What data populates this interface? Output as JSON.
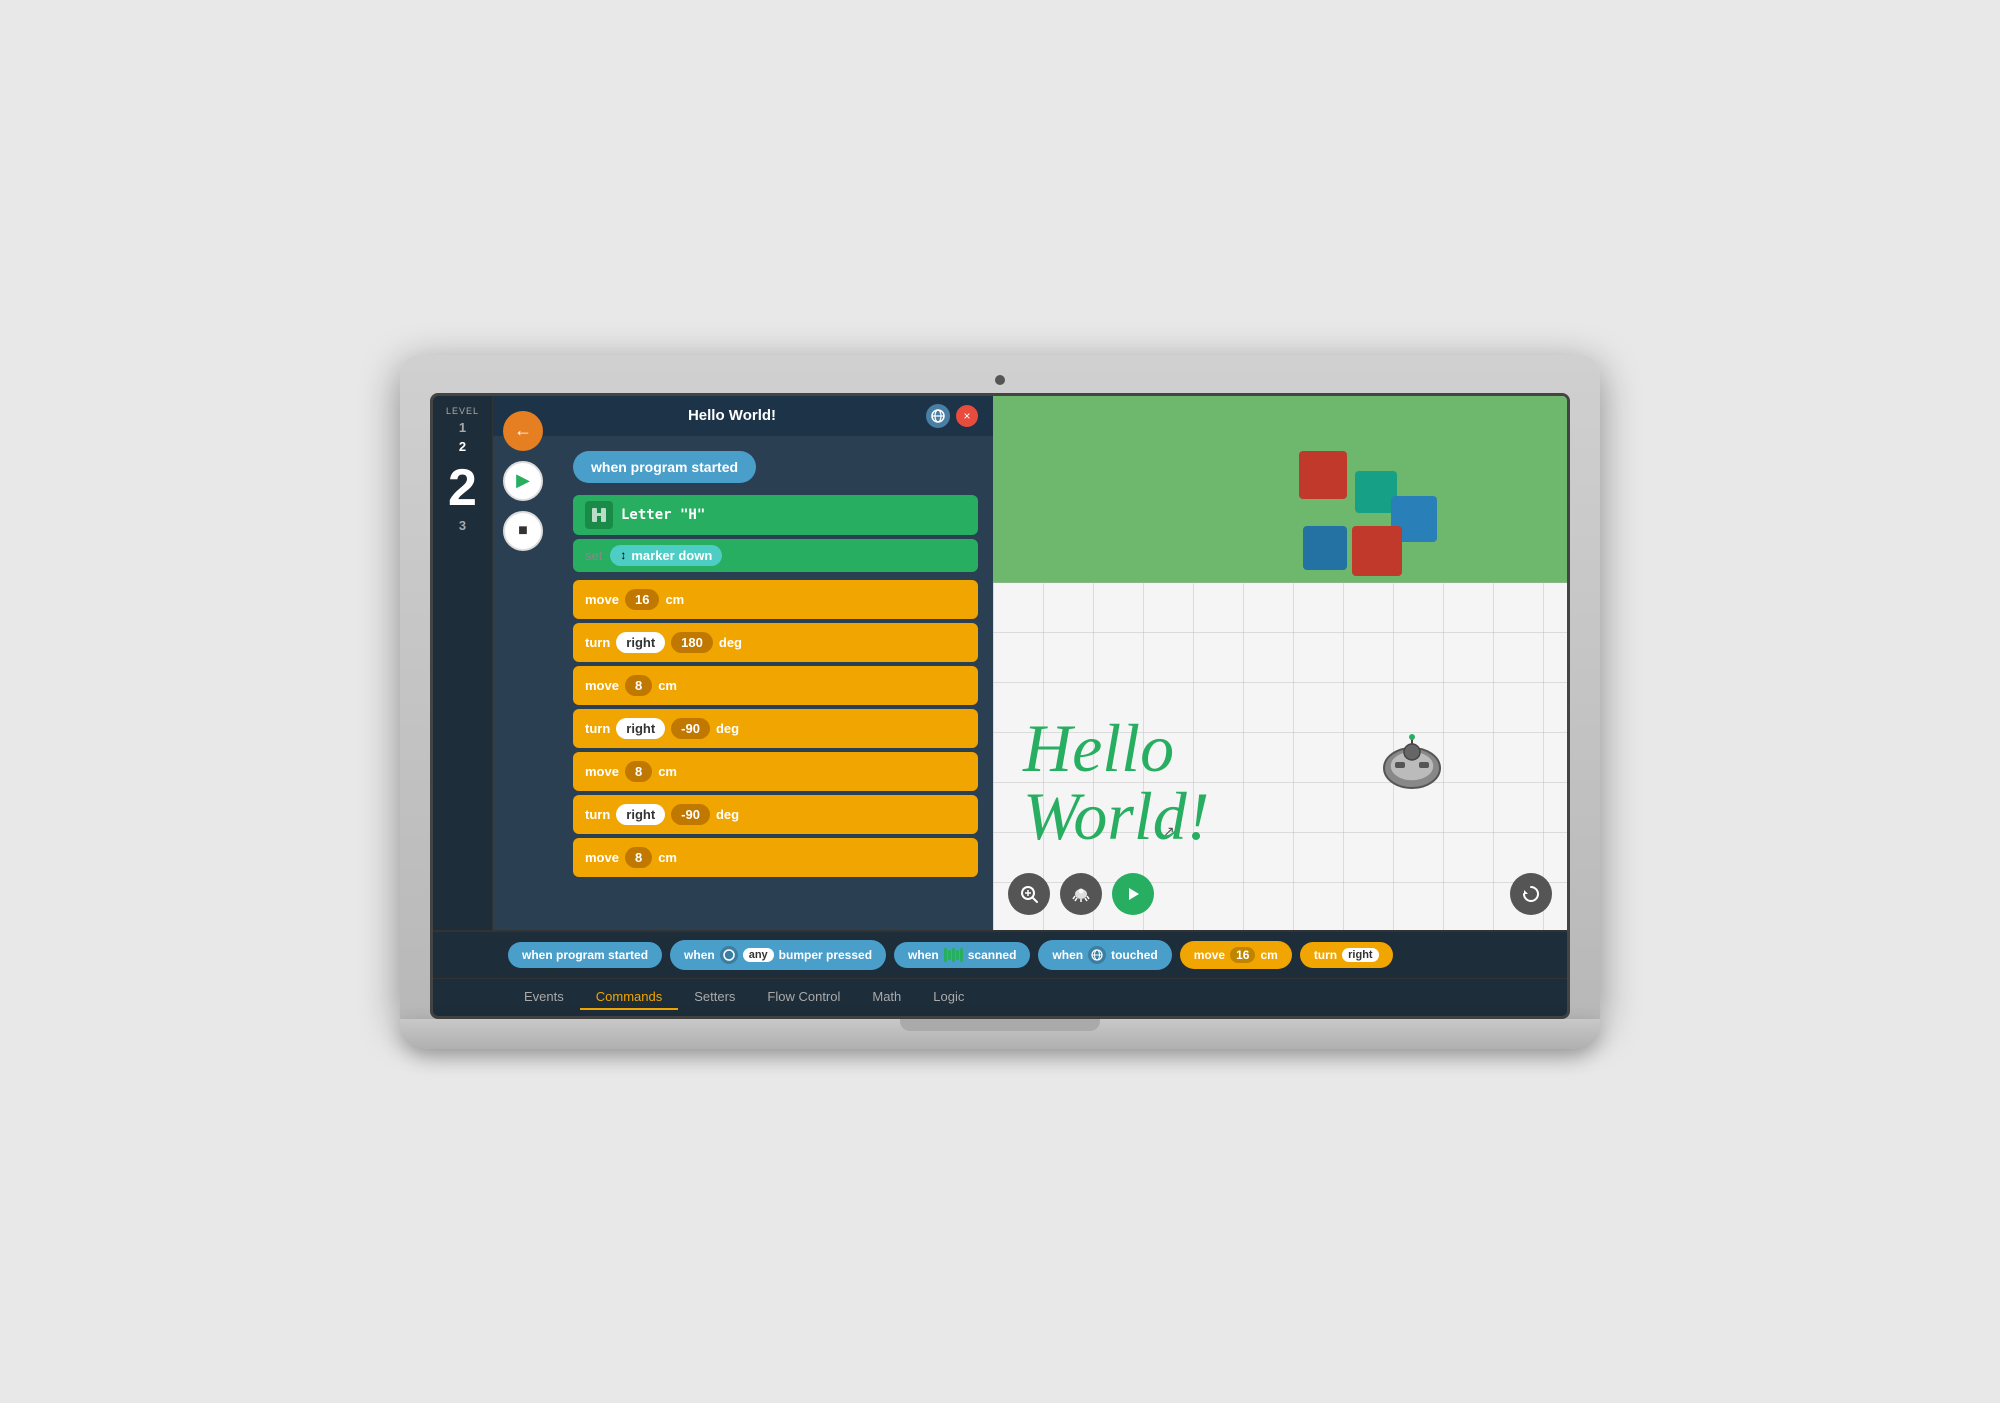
{
  "laptop": {
    "title": "Hello World!"
  },
  "header": {
    "title": "Hello World!",
    "back_label": "←",
    "close_label": "×"
  },
  "controls": {
    "play_label": "▶",
    "stop_label": "■",
    "zoom_label": "+"
  },
  "code": {
    "trigger": "when program started",
    "letter_block": "Letter \"H\"",
    "marker_label": "set",
    "marker_text": "marker down",
    "blocks": [
      {
        "label": "move",
        "value1": "16",
        "unit": "cm"
      },
      {
        "label": "turn",
        "dir": "right",
        "value2": "180",
        "unit": "deg"
      },
      {
        "label": "move",
        "value1": "8",
        "unit": "cm"
      },
      {
        "label": "turn",
        "dir": "right",
        "value2": "-90",
        "unit": "deg"
      },
      {
        "label": "move",
        "value1": "8",
        "unit": "cm"
      },
      {
        "label": "turn",
        "dir": "right",
        "value2": "-90",
        "unit": "deg"
      },
      {
        "label": "move",
        "value1": "8",
        "unit": "cm"
      }
    ]
  },
  "simulator": {
    "hello_text": "Hello\nWorld!",
    "cursor": "↖"
  },
  "palette": {
    "blocks": [
      {
        "type": "blue",
        "label": "when program started",
        "icon": ""
      },
      {
        "type": "blue",
        "label": "any bumper pressed",
        "icon": "any"
      },
      {
        "type": "blue",
        "label": "scanned",
        "icon": "barcode"
      },
      {
        "type": "blue",
        "label": "when touched",
        "icon": "globe"
      },
      {
        "type": "yellow",
        "label": "move 16 cm",
        "icon": ""
      },
      {
        "type": "yellow",
        "label": "turn right",
        "icon": ""
      }
    ]
  },
  "tabs": [
    {
      "label": "Events",
      "state": "inactive"
    },
    {
      "label": "Commands",
      "state": "active"
    },
    {
      "label": "Setters",
      "state": "inactive"
    },
    {
      "label": "Flow Control",
      "state": "inactive"
    },
    {
      "label": "Math",
      "state": "inactive"
    },
    {
      "label": "Logic",
      "state": "inactive"
    }
  ],
  "levels": {
    "label": "LEVEL",
    "current": "2",
    "items": [
      "1",
      "2",
      "3"
    ]
  },
  "sim_controls": {
    "zoom_label": "🔍",
    "turtle_label": "🐢",
    "play_label": "▶",
    "reset_label": "↺"
  }
}
